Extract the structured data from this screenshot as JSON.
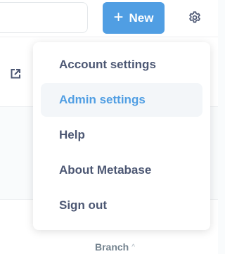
{
  "header": {
    "search": {
      "placeholder": ""
    },
    "new_button": {
      "icon": "plus-icon",
      "label": "New",
      "color": "#509ee3"
    },
    "settings_icon": "gear-icon"
  },
  "background": {
    "external_link_icon": "external-link-icon",
    "column_header": {
      "label": "Branch",
      "sort_icon": "chevron-up-icon"
    }
  },
  "settings_menu": {
    "items": [
      {
        "label": "Account settings",
        "active": false
      },
      {
        "label": "Admin settings",
        "active": true
      },
      {
        "label": "Help",
        "active": false
      },
      {
        "label": "About Metabase",
        "active": false
      },
      {
        "label": "Sign out",
        "active": false
      }
    ],
    "active_color": "#509ee3",
    "text_color": "#4c5773"
  }
}
